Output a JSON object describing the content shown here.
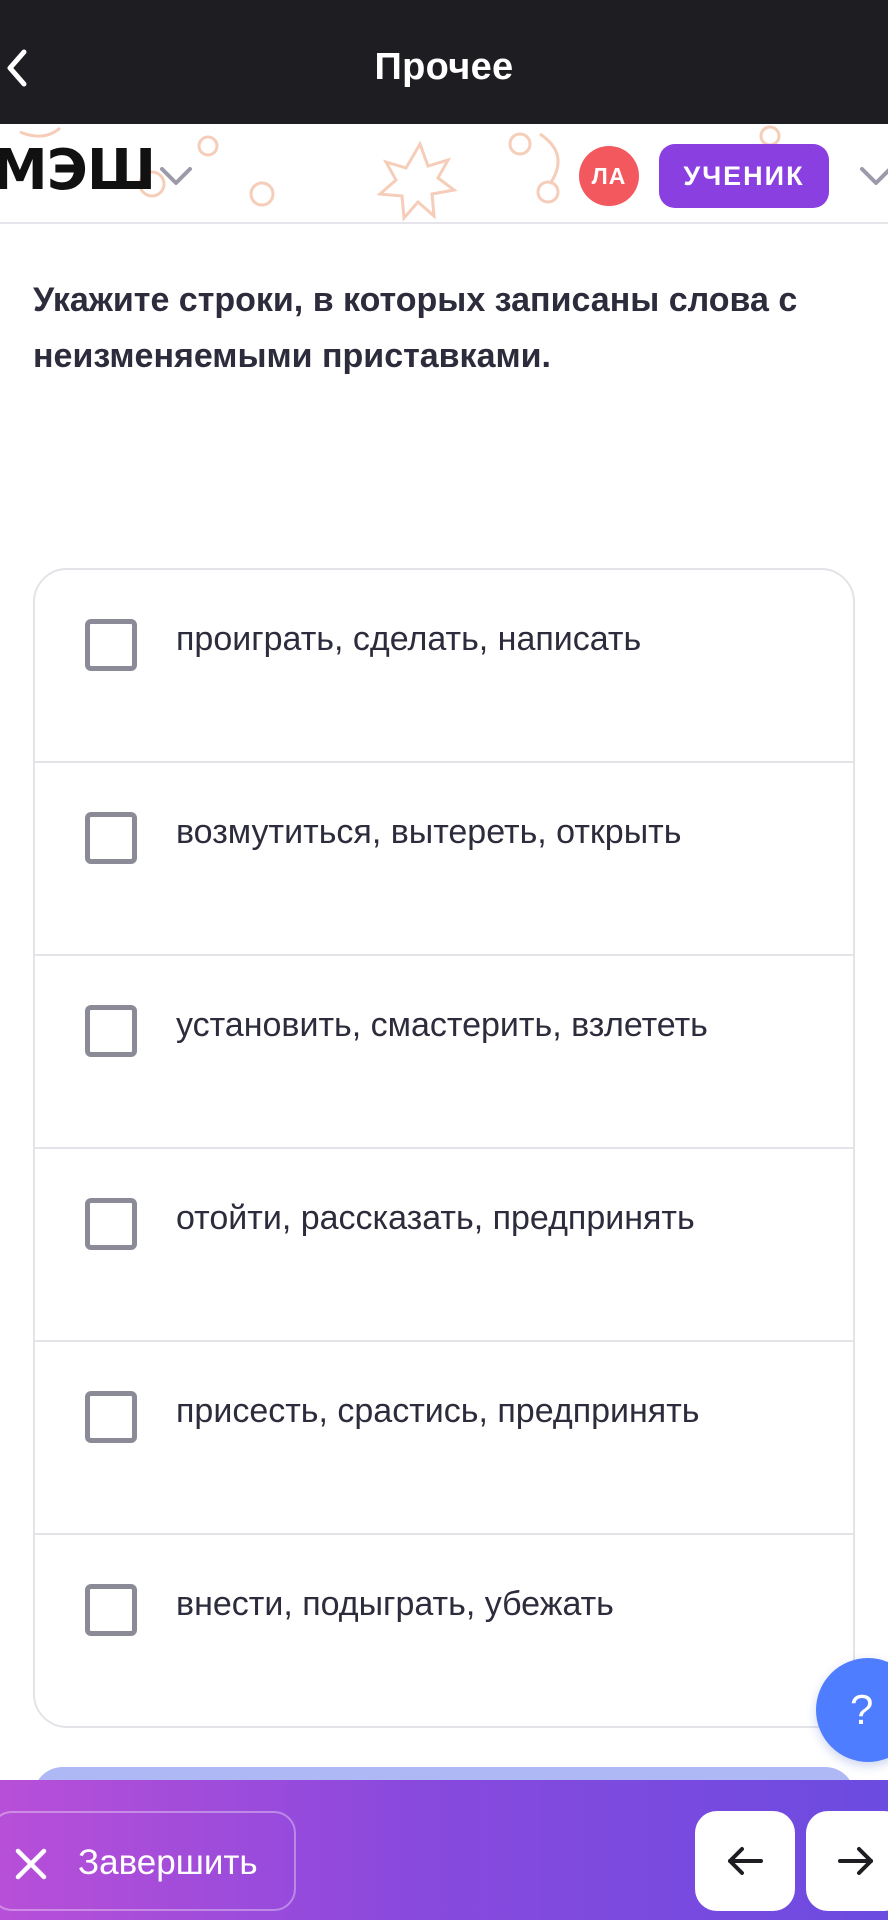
{
  "topbar": {
    "title": "Прочее",
    "back_icon": "chevron-left-icon"
  },
  "header": {
    "logo": "МЭШ",
    "avatar_initials": "ЛА",
    "avatar_color": "#f2585e",
    "role_label": "УЧЕНИК",
    "role_color": "#8a3fe0"
  },
  "question": {
    "text": "Укажите строки, в которых записаны слова с неизменяемыми приставками."
  },
  "options": [
    {
      "label": "проиграть, сделать, написать",
      "checked": false
    },
    {
      "label": "возмутиться, вытереть, открыть",
      "checked": false
    },
    {
      "label": "установить, смастерить, взлететь",
      "checked": false
    },
    {
      "label": "отойти, рассказать, предпринять",
      "checked": false
    },
    {
      "label": "присесть, срастись, предпринять",
      "checked": false
    },
    {
      "label": "внести, подыграть, убежать",
      "checked": false
    }
  ],
  "help": {
    "label": "?",
    "color": "#4f7dff"
  },
  "footer": {
    "finish_label": "Завершить",
    "prev_icon": "arrow-left-icon",
    "next_icon": "arrow-right-icon"
  }
}
